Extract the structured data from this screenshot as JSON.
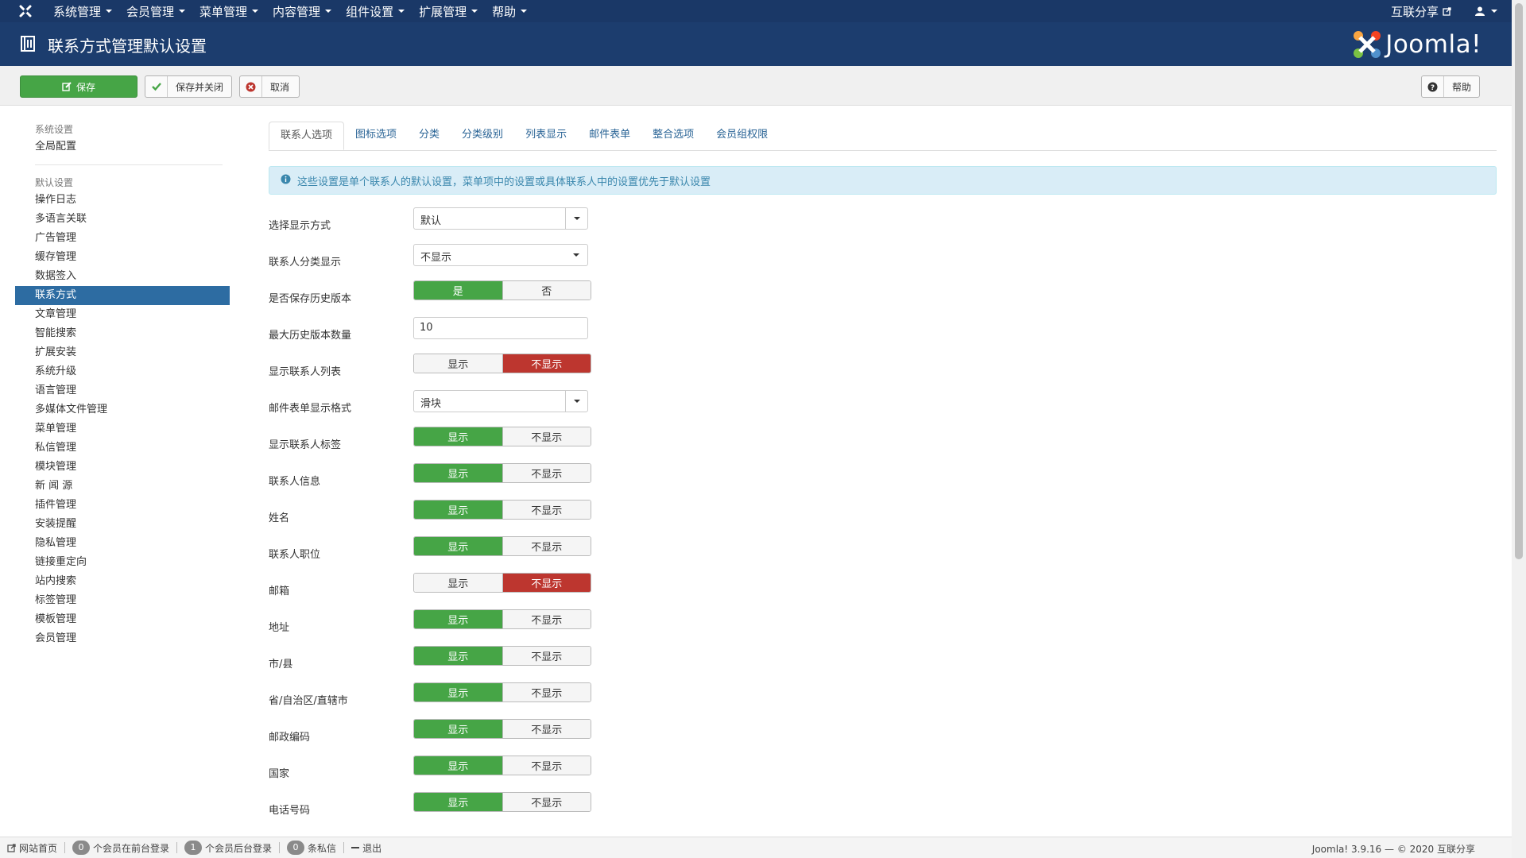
{
  "navbar": {
    "menu": [
      "系统管理",
      "会员管理",
      "菜单管理",
      "内容管理",
      "组件设置",
      "扩展管理",
      "帮助"
    ],
    "site_link": "互联分享"
  },
  "header": {
    "title": "联系方式管理默认设置",
    "brand": "Joomla!"
  },
  "toolbar": {
    "save": "保存",
    "save_close": "保存并关闭",
    "cancel": "取消",
    "help": "帮助"
  },
  "sidebar": {
    "section1_title": "系统设置",
    "section1_items": [
      "全局配置"
    ],
    "section2_title": "默认设置",
    "section2_items": [
      "操作日志",
      "多语言关联",
      "广告管理",
      "缓存管理",
      "数据签入",
      "联系方式",
      "文章管理",
      "智能搜索",
      "扩展安装",
      "系统升级",
      "语言管理",
      "多媒体文件管理",
      "菜单管理",
      "私信管理",
      "模块管理",
      "新 闻 源",
      "插件管理",
      "安装提醒",
      "隐私管理",
      "链接重定向",
      "站内搜索",
      "标签管理",
      "模板管理",
      "会员管理"
    ],
    "active_item": "联系方式"
  },
  "tabs": [
    "联系人选项",
    "图标选项",
    "分类",
    "分类级别",
    "列表显示",
    "邮件表单",
    "整合选项",
    "会员组权限"
  ],
  "alert": "这些设置是单个联系人的默认设置，菜单项中的设置或具体联系人中的设置优先于默认设置",
  "form": {
    "display_mode": {
      "label": "选择显示方式",
      "value": "默认"
    },
    "category_display": {
      "label": "联系人分类显示",
      "value": "不显示"
    },
    "save_history": {
      "label": "是否保存历史版本",
      "yes": "是",
      "no": "否",
      "selected": "是"
    },
    "max_versions": {
      "label": "最大历史版本数量",
      "value": "10"
    },
    "show_list": {
      "label": "显示联系人列表",
      "show": "显示",
      "hide": "不显示",
      "selected": "不显示"
    },
    "mail_format": {
      "label": "邮件表单显示格式",
      "value": "滑块"
    },
    "toggles": [
      {
        "label": "显示联系人标签",
        "selected": "显示"
      },
      {
        "label": "联系人信息",
        "selected": "显示"
      },
      {
        "label": "姓名",
        "selected": "显示"
      },
      {
        "label": "联系人职位",
        "selected": "显示"
      },
      {
        "label": "邮箱",
        "selected": "不显示"
      },
      {
        "label": "地址",
        "selected": "显示"
      },
      {
        "label": "市/县",
        "selected": "显示"
      },
      {
        "label": "省/自治区/直辖市",
        "selected": "显示"
      },
      {
        "label": "邮政编码",
        "selected": "显示"
      },
      {
        "label": "国家",
        "selected": "显示"
      },
      {
        "label": "电话号码",
        "selected": "显示"
      }
    ],
    "show_label": "显示",
    "hide_label": "不显示"
  },
  "statusbar": {
    "site_home": "网站首页",
    "frontend_count": "0",
    "frontend_text": "个会员在前台登录",
    "backend_count": "1",
    "backend_text": "个会员后台登录",
    "messages_count": "0",
    "messages_text": "条私信",
    "logout": "退出",
    "version": "Joomla! 3.9.16 — © 2020 互联分享"
  },
  "colors": {
    "nav": "#1a3867",
    "header": "#1c3d6e",
    "green": "#46a546",
    "red": "#bd362f",
    "active": "#2d6ca2"
  }
}
